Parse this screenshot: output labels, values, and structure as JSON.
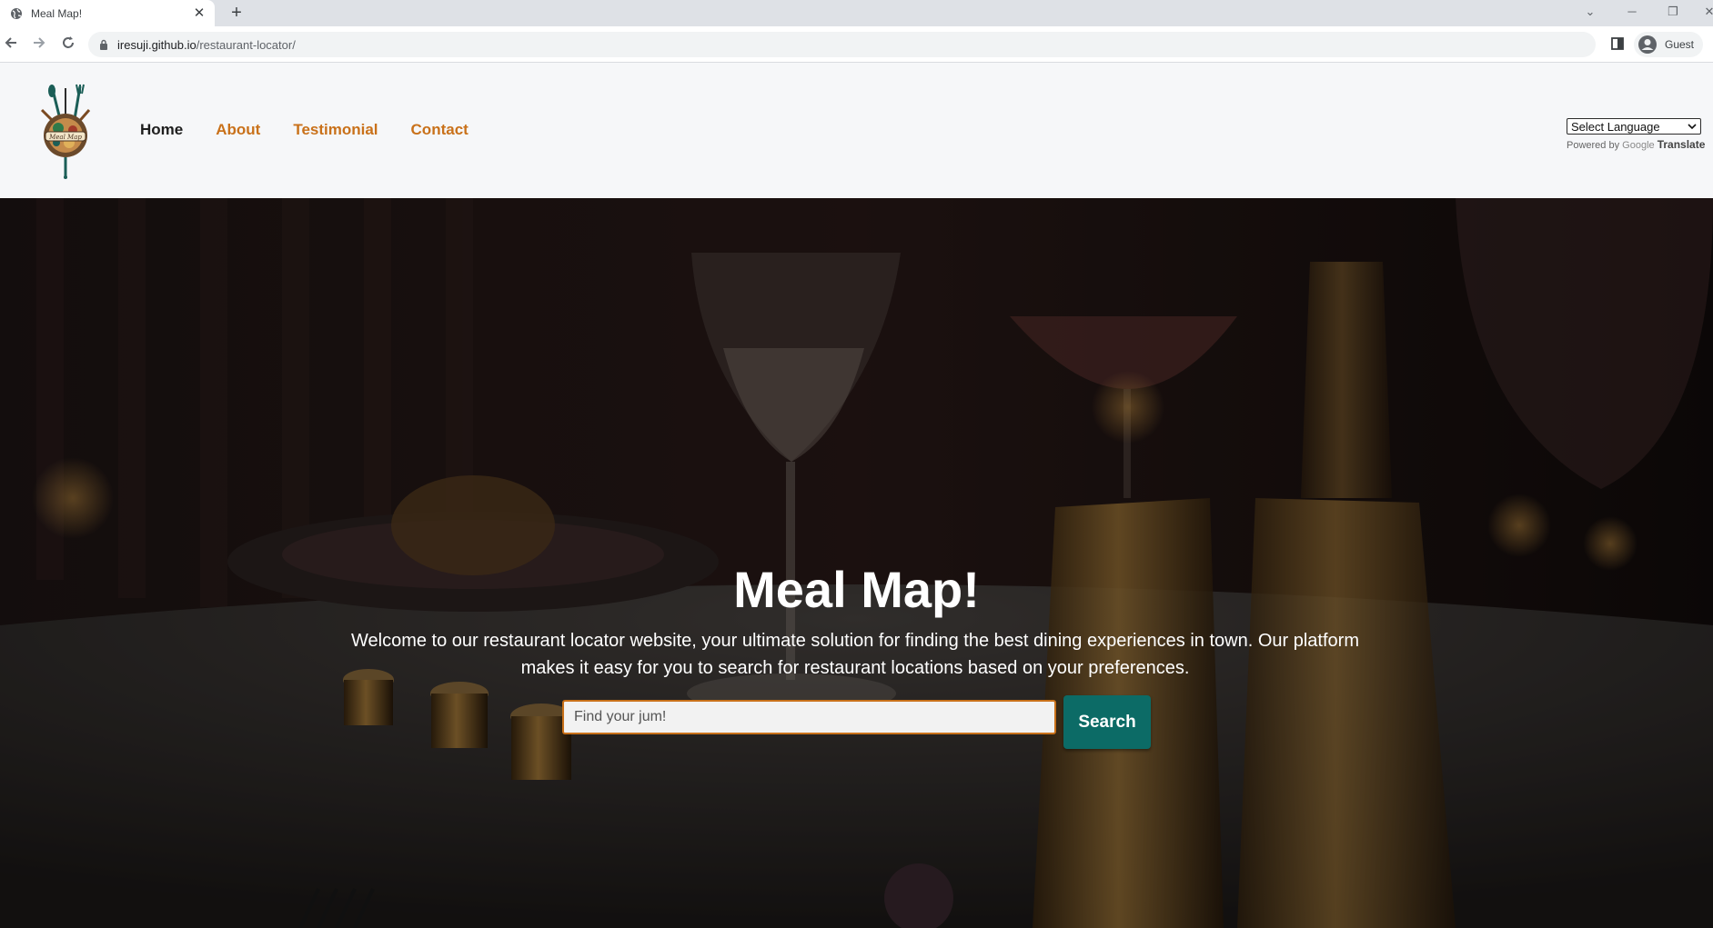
{
  "browser": {
    "tab_title": "Meal Map!",
    "tab_close": "✕",
    "new_tab": "+",
    "url_host": "iresuji.github.io",
    "url_path": "/restaurant-locator/",
    "profile_label": "Guest"
  },
  "header": {
    "logo_text": "Meal Map",
    "nav": [
      {
        "label": "Home",
        "active": true
      },
      {
        "label": "About",
        "active": false
      },
      {
        "label": "Testimonial",
        "active": false
      },
      {
        "label": "Contact",
        "active": false
      }
    ],
    "translate": {
      "selected": "Select Language",
      "powered_by": "Powered by",
      "google": "Google",
      "translate_label": "Translate"
    }
  },
  "hero": {
    "title": "Meal Map!",
    "description": "Welcome to our restaurant locator website, your ultimate solution for finding the best dining experiences in town. Our platform makes it easy for you to search for restaurant locations based on your preferences.",
    "search_placeholder": "Find your jum!",
    "search_button": "Search"
  },
  "colors": {
    "nav_link": "#c9711a",
    "nav_active": "#1e1e1e",
    "search_button_bg": "#0c6b66",
    "search_input_border": "#c9711a"
  },
  "icons": {
    "tab_favicon": "globe-icon",
    "back": "arrow-left-icon",
    "forward": "arrow-right-icon",
    "reload": "reload-icon",
    "secure": "lock-icon",
    "side_panel": "side-panel-icon",
    "profile": "avatar-icon"
  }
}
